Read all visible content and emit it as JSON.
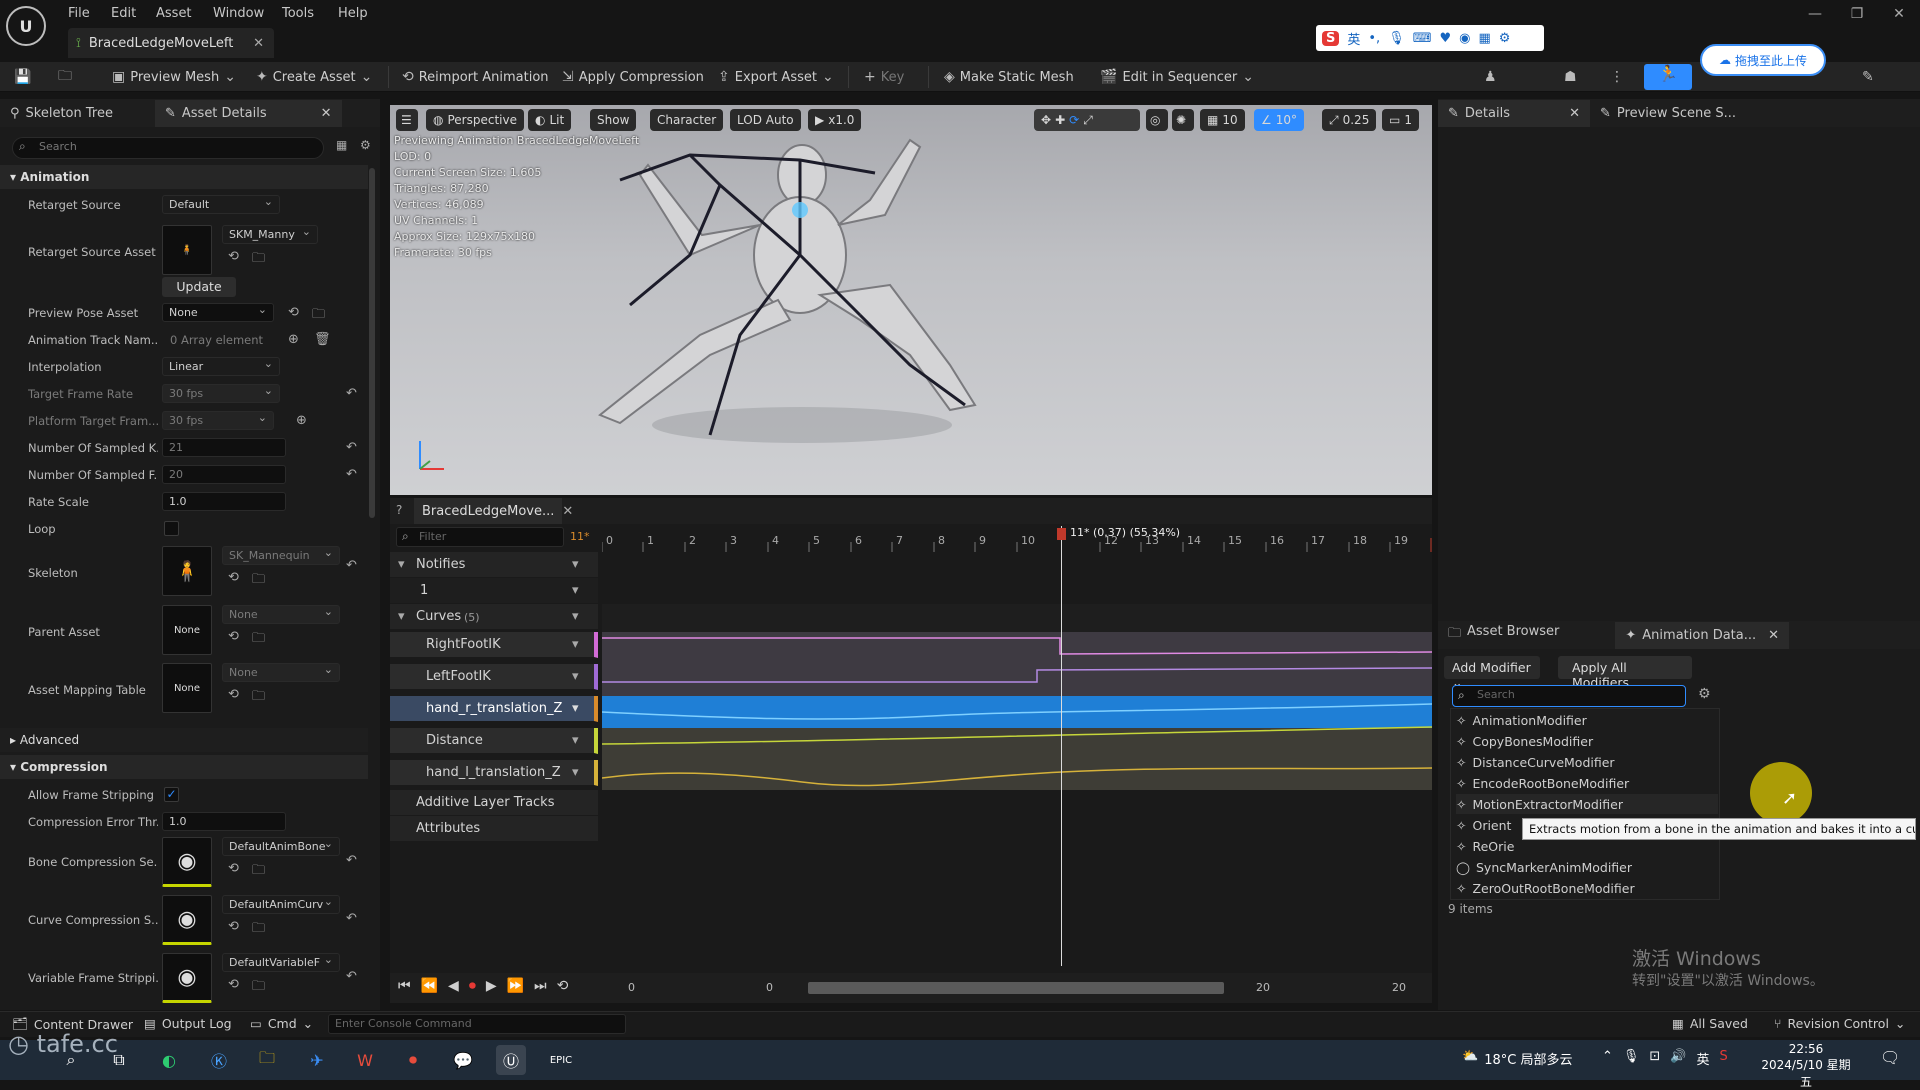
{
  "app": {
    "doc_tab": "BracedLedgeMoveLeft"
  },
  "menu": [
    "File",
    "Edit",
    "Asset",
    "Window",
    "Tools",
    "Help"
  ],
  "ime": {
    "lang": "英",
    "upload_btn": "拖拽至此上传"
  },
  "toolbar": {
    "preview_mesh": "Preview Mesh",
    "create_asset": "Create Asset",
    "reimport": "Reimport Animation",
    "apply_compression": "Apply Compression",
    "export_asset": "Export Asset",
    "key": "Key",
    "make_static_mesh": "Make Static Mesh",
    "edit_in_sequencer": "Edit in Sequencer"
  },
  "left": {
    "tab_skeleton": "Skeleton Tree",
    "tab_asset_details": "Asset Details",
    "search_placeholder": "Search",
    "cat_animation": "Animation",
    "rows": {
      "retarget_source": {
        "label": "Retarget Source",
        "value": "Default"
      },
      "retarget_source_asset": {
        "label": "Retarget Source Asset",
        "value": "SKM_Manny",
        "btn": "Update"
      },
      "preview_pose_asset": {
        "label": "Preview Pose Asset",
        "value": "None"
      },
      "anim_track_names": {
        "label": "Animation Track Nam...",
        "value": "0 Array element"
      },
      "interpolation": {
        "label": "Interpolation",
        "value": "Linear"
      },
      "target_frame_rate": {
        "label": "Target Frame Rate",
        "value": "30 fps"
      },
      "platform_target": {
        "label": "Platform Target Fram...",
        "value": "30 fps"
      },
      "num_sampled_k": {
        "label": "Number Of Sampled K...",
        "value": "21"
      },
      "num_sampled_f": {
        "label": "Number Of Sampled F...",
        "value": "20"
      },
      "rate_scale": {
        "label": "Rate Scale",
        "value": "1.0"
      },
      "loop": {
        "label": "Loop"
      },
      "skeleton": {
        "label": "Skeleton",
        "value": "SK_Mannequin"
      },
      "parent_asset": {
        "label": "Parent Asset",
        "value": "None",
        "thumb": "None"
      },
      "asset_mapping": {
        "label": "Asset Mapping Table",
        "value": "None",
        "thumb": "None"
      }
    },
    "cat_advanced": "Advanced",
    "cat_compression": "Compression",
    "comp_rows": {
      "allow_frame_stripping": {
        "label": "Allow Frame Stripping"
      },
      "compression_error": {
        "label": "Compression Error Thr...",
        "value": "1.0"
      },
      "bone_compression": {
        "label": "Bone Compression Se...",
        "value": "DefaultAnimBone"
      },
      "curve_compression": {
        "label": "Curve Compression S...",
        "value": "DefaultAnimCurv"
      },
      "variable_frame": {
        "label": "Variable Frame Strippi...",
        "value": "DefaultVariableF"
      }
    }
  },
  "viewport": {
    "buttons": [
      "Perspective",
      "Lit",
      "Show",
      "Character",
      "LOD Auto",
      "x1.0"
    ],
    "right_vals": [
      "10",
      "10°",
      "0.25",
      "1"
    ],
    "overlay": [
      "Previewing Animation BracedLedgeMoveLeft",
      "LOD: 0",
      "Current Screen Size: 1.605",
      "Triangles: 87,280",
      "Vertices: 46,089",
      "UV Channels: 1",
      "Approx Size: 129x75x180",
      "Framerate: 30 fps"
    ]
  },
  "sequencer": {
    "tab": "BracedLedgeMove...",
    "filter_placeholder": "Filter",
    "frame_badge": "11*",
    "playhead_label": "11* (0.37) (55.34%)",
    "notifies": "Notifies",
    "notify_track": "1",
    "curves": "Curves",
    "curves_count": "(5)",
    "tracks": [
      "RightFootIK",
      "LeftFootIK",
      "hand_r_translation_Z",
      "Distance",
      "hand_l_translation_Z"
    ],
    "additive": "Additive Layer Tracks",
    "attributes": "Attributes",
    "ticks": [
      "0",
      "1",
      "2",
      "3",
      "4",
      "5",
      "6",
      "7",
      "8",
      "9",
      "10",
      "12",
      "13",
      "14",
      "15",
      "16",
      "17",
      "18",
      "19"
    ],
    "bottom_left": "0",
    "bottom_mid": "0",
    "bottom_r1": "20",
    "bottom_r2": "20"
  },
  "right": {
    "tab_details": "Details",
    "tab_preview_scene": "Preview Scene S...",
    "tab_asset_browser": "Asset Browser",
    "tab_anim_data": "Animation Data...",
    "add_modifier": "Add Modifier",
    "apply_all": "Apply All Modifiers",
    "search_placeholder": "Search",
    "modifiers": [
      "AnimationModifier",
      "CopyBonesModifier",
      "DistanceCurveModifier",
      "EncodeRootBoneModifier",
      "MotionExtractorModifier",
      "Orient",
      "ReOrie",
      "SyncMarkerAnimModifier",
      "ZeroOutRootBoneModifier"
    ],
    "items_count": "9 items",
    "tooltip": "Extracts motion from a bone in the animation and bakes it into a curve",
    "watermark1": "激活 Windows",
    "watermark2": "转到\"设置\"以激活 Windows。"
  },
  "status": {
    "content_drawer": "Content Drawer",
    "output_log": "Output Log",
    "cmd": "Cmd",
    "console_placeholder": "Enter Console Command",
    "all_saved": "All Saved",
    "revision": "Revision Control"
  },
  "taskbar": {
    "weather": "18°C 局部多云",
    "lang": "英",
    "time": "22:56",
    "date": "2024/5/10 星期五",
    "watermark": "tafe.cc"
  }
}
